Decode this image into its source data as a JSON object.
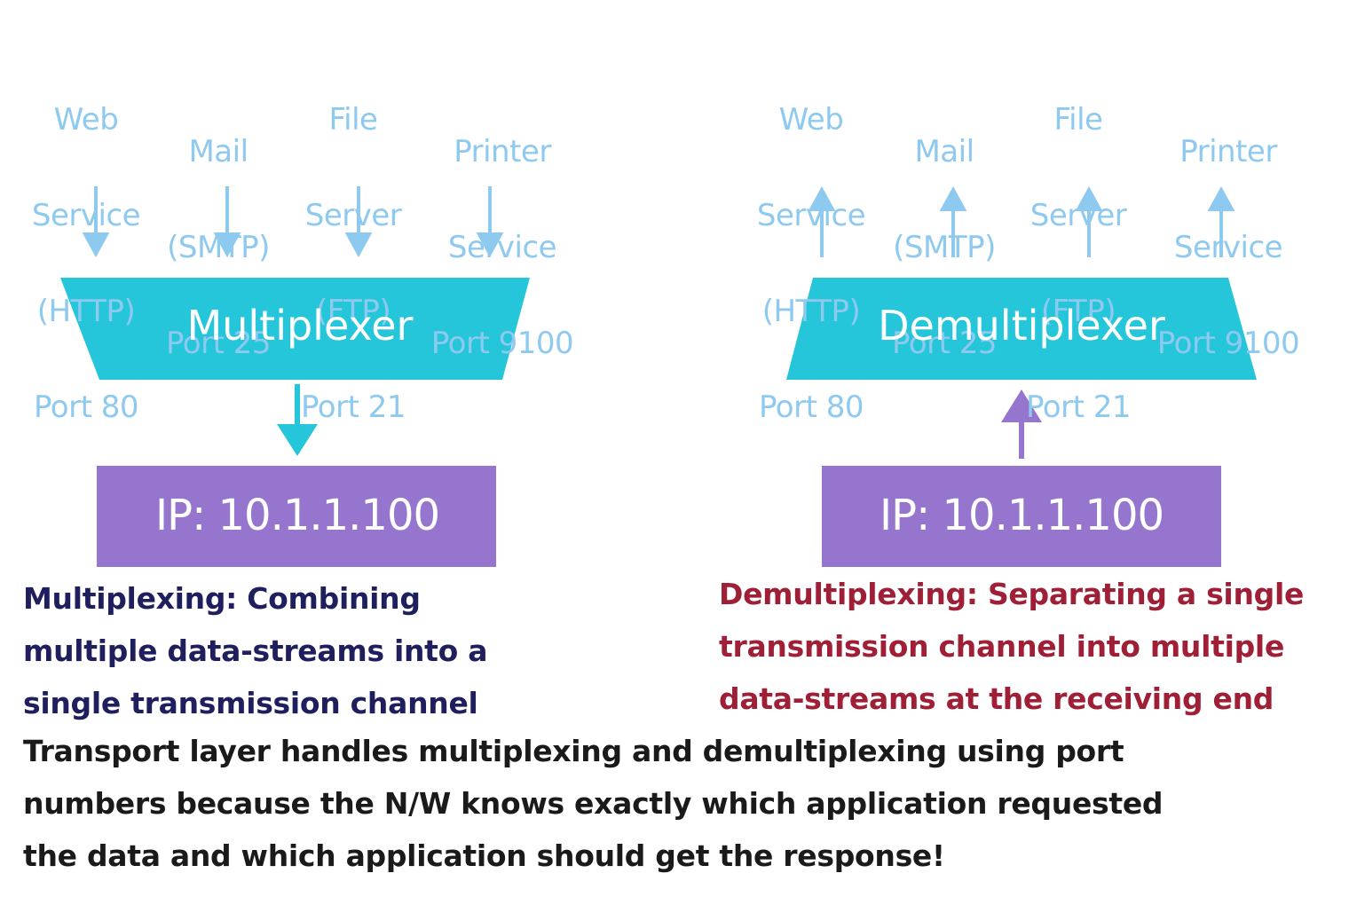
{
  "left_panel": {
    "services": [
      {
        "lines": [
          "Web",
          "Service",
          "(HTTP)",
          "Port 80"
        ]
      },
      {
        "lines": [
          "Mail",
          "(SMTP)",
          "Port 25"
        ]
      },
      {
        "lines": [
          "File",
          "Server",
          "(FTP)",
          "Port 21"
        ]
      },
      {
        "lines": [
          "Printer",
          "Service",
          "Port 9100"
        ]
      }
    ],
    "box_label": "Multiplexer",
    "ip_label": "IP: 10.1.1.100"
  },
  "right_panel": {
    "services": [
      {
        "lines": [
          "Web",
          "Service",
          "(HTTP)",
          "Port 80"
        ]
      },
      {
        "lines": [
          "Mail",
          "(SMTP)",
          "Port 25"
        ]
      },
      {
        "lines": [
          "File",
          "Server",
          "(FTP)",
          "Port 21"
        ]
      },
      {
        "lines": [
          "Printer",
          "Service",
          "Port 9100"
        ]
      }
    ],
    "box_label": "Demultiplexer",
    "ip_label": "IP: 10.1.1.100"
  },
  "captions": {
    "multiplexing": "Multiplexing: Combining\nmultiple data-streams into a\nsingle transmission channel",
    "demultiplexing": "Demultiplexing: Separating a single\ntransmission channel into multiple\ndata-streams at the receiving end",
    "note": "Transport layer handles multiplexing and demultiplexing using port\nnumbers because the N/W knows exactly which application requested\nthe data and which application should get the response!"
  },
  "colors": {
    "service_text": "#8ec9ef",
    "service_arrow": "#8ec9ef",
    "mux_box": "#26c6da",
    "ip_box": "#9575cd",
    "mux_caption": "#1f1f5e",
    "demux_caption": "#9e1f36",
    "note_caption": "#1a1a1a"
  }
}
